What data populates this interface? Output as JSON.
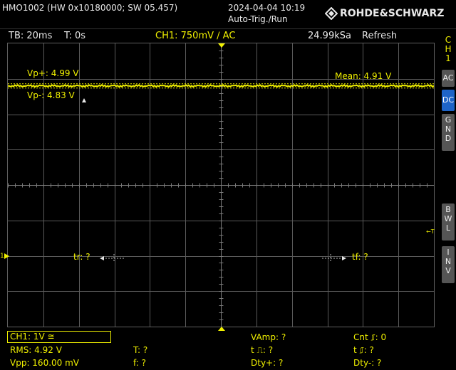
{
  "header": {
    "device": "HMO1002 (HW 0x10180000; SW 05.457)",
    "datetime": "2024-04-04 10:19",
    "trigger_mode": "Auto-Trig./Run",
    "brand": "ROHDE&SCHWARZ"
  },
  "status": {
    "timebase": "TB: 20ms",
    "trigger_time": "T: 0s",
    "channel": "CH1: 750mV ∕ AC",
    "sample_rate": "24.99kSa",
    "acq_mode": "Refresh"
  },
  "side_panel": {
    "channel_label": [
      "C",
      "H",
      "1"
    ],
    "ac": "AC",
    "dc": "DC",
    "gnd": [
      "G",
      "N",
      "D"
    ],
    "bwl": [
      "B",
      "W",
      "L"
    ],
    "inv": [
      "I",
      "N",
      "V"
    ]
  },
  "screen": {
    "vp_plus": "Vp+: 4.99 V",
    "vp_minus": "Vp-: 4.83 V",
    "mean": "Mean: 4.91 V",
    "tr": "tr: ?",
    "tf": "tf: ?",
    "ch_marker": "1",
    "trig_marker": "←T",
    "trace_level_fraction": 0.15
  },
  "measurements": {
    "channel_setting": "CH1: 1V ≅",
    "rms": "RMS: 4.92 V",
    "vpp": "Vpp: 160.00 mV",
    "t": "T: ?",
    "f": "f: ?",
    "vamp": "VAmp: ?",
    "t_pulse_pos": "t ⎍: ?",
    "dty_pos": "Dty+: ?",
    "cnt": "Cnt ⎎: 0",
    "t_pulse_neg": "t ⎎: ?",
    "dty_neg": "Dty-: ?"
  },
  "colors": {
    "trace": "#f0f000",
    "grid": "#5a5a5a",
    "active_coupling": "#1e64c8"
  }
}
